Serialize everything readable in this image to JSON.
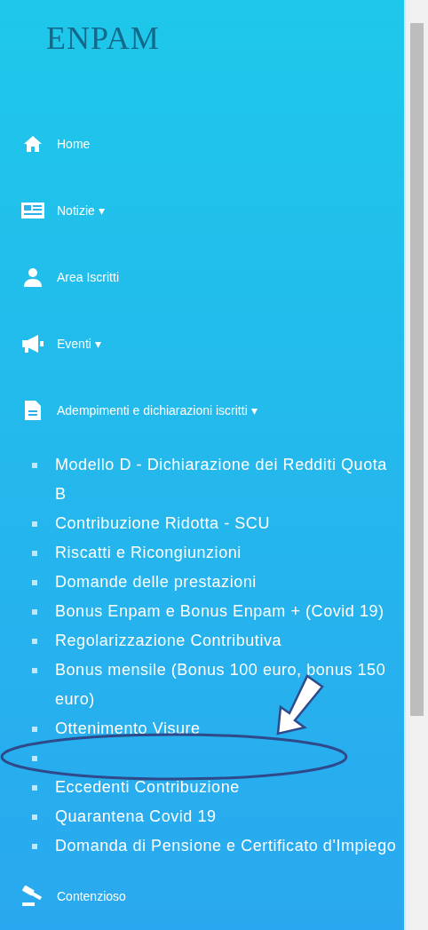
{
  "logo": {
    "text": "ENPAM"
  },
  "menu": [
    {
      "label": "Home"
    },
    {
      "label": "Notizie",
      "caret": "▾"
    },
    {
      "label": "Area Iscritti"
    },
    {
      "label": "Eventi",
      "caret": "▾"
    },
    {
      "label": "Adempimenti e dichiarazioni iscritti",
      "caret": "▾",
      "expanded": true,
      "children": [
        {
          "kind": "text",
          "label": "Modello D - Dichiarazione dei Redditi Quota B"
        },
        {
          "kind": "text",
          "label": "Contribuzione Ridotta - SCU"
        },
        {
          "kind": "text",
          "label": "Riscatti e Ricongiunzioni"
        },
        {
          "kind": "text",
          "label": "Domande delle prestazioni"
        },
        {
          "kind": "text",
          "label": "Bonus Enpam e Bonus Enpam + (Covid 19)"
        },
        {
          "kind": "text",
          "label": "Regolarizzazione Contributiva"
        },
        {
          "kind": "text",
          "label": "Bonus mensile (Bonus 100 euro, bonus 150 euro)"
        },
        {
          "kind": "text",
          "label": "Ottenimento Visure"
        },
        {
          "kind": "blank"
        },
        {
          "kind": "text",
          "label": "Eccedenti Contribuzione"
        },
        {
          "kind": "text",
          "label": "Quarantena Covid 19"
        },
        {
          "kind": "text",
          "label": "Domanda di Pensione e Certificato d'Impiego"
        }
      ]
    },
    {
      "label": "Contenzioso"
    }
  ],
  "annotations": {
    "ellipse": true,
    "arrow": true
  }
}
